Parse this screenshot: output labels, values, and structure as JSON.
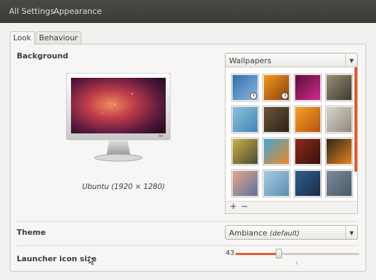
{
  "topbar": {
    "all_settings": "All Settings",
    "appearance": "Appearance"
  },
  "tabs": [
    {
      "label": "Look",
      "active": true
    },
    {
      "label": "Behaviour",
      "active": false
    }
  ],
  "background": {
    "label": "Background",
    "preview_caption": "Ubuntu (1920 × 1280)",
    "source_combo": "Wallpapers",
    "add_label": "+",
    "remove_label": "−",
    "thumbnails": [
      {
        "name": "blue-streaks",
        "colors": [
          "#2d6fae",
          "#8fb6dc"
        ],
        "slideshow": true
      },
      {
        "name": "orange-flower",
        "colors": [
          "#f29a1a",
          "#8a3e10"
        ],
        "slideshow": true
      },
      {
        "name": "purple-glow",
        "colors": [
          "#5a1038",
          "#d02a8c"
        ],
        "slideshow": false
      },
      {
        "name": "cream-flower",
        "colors": [
          "#9b8f73",
          "#3d3a30"
        ],
        "slideshow": false
      },
      {
        "name": "birds-sky",
        "colors": [
          "#8fc2dd",
          "#3f86b5"
        ],
        "slideshow": false
      },
      {
        "name": "brown-texture",
        "colors": [
          "#6b5438",
          "#2d241a"
        ],
        "slideshow": false
      },
      {
        "name": "orange-petal",
        "colors": [
          "#f7a22b",
          "#b8520c"
        ],
        "slideshow": false
      },
      {
        "name": "white-dandelion",
        "colors": [
          "#d9d5cc",
          "#8f877a"
        ],
        "slideshow": false
      },
      {
        "name": "yellow-bokeh",
        "colors": [
          "#c9b24a",
          "#4c4a2f"
        ],
        "slideshow": false
      },
      {
        "name": "cartoon-bird",
        "colors": [
          "#3da6d8",
          "#f08a22"
        ],
        "slideshow": false
      },
      {
        "name": "red-leaf",
        "colors": [
          "#8a2a1a",
          "#3a120a"
        ],
        "slideshow": false
      },
      {
        "name": "orange-ring",
        "colors": [
          "#2a241c",
          "#e8841a"
        ],
        "slideshow": false
      },
      {
        "name": "dusk-sky",
        "colors": [
          "#e4a88c",
          "#5f6f9a"
        ],
        "slideshow": false
      },
      {
        "name": "paper-boat",
        "colors": [
          "#a9cbdf",
          "#5a8fb3"
        ],
        "slideshow": false
      },
      {
        "name": "blue-lines",
        "colors": [
          "#2f5f8d",
          "#1a2d45"
        ],
        "slideshow": false
      },
      {
        "name": "gray-water",
        "colors": [
          "#7b8c9a",
          "#4b5966"
        ],
        "slideshow": false
      }
    ]
  },
  "theme": {
    "label": "Theme",
    "value": "Ambiance",
    "hint": "(default)"
  },
  "launcher": {
    "label": "Launcher icon size",
    "value_text": "43",
    "fraction": 0.35
  },
  "colors": {
    "accent": "#e3582b"
  }
}
